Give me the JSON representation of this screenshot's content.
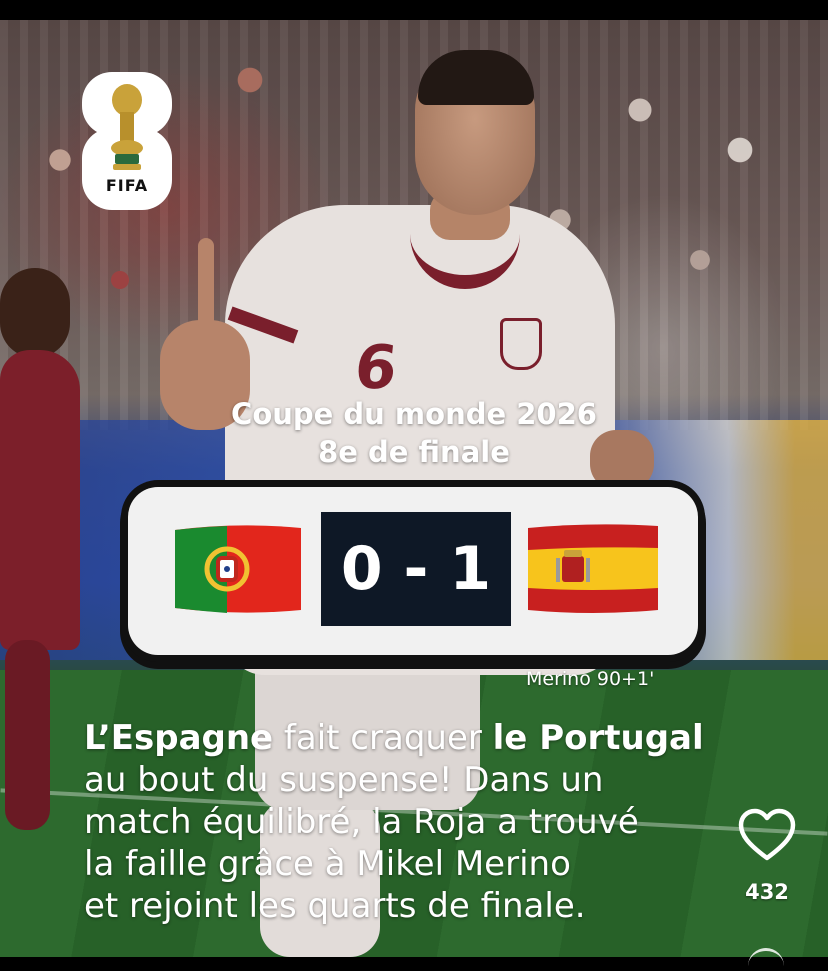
{
  "logo": {
    "badge_text": "FIFA",
    "year_graphic": "26"
  },
  "match": {
    "competition_line1": "Coupe du monde 2026",
    "competition_line2": "8e de finale",
    "home_team_flag": "portugal-flag",
    "away_team_flag": "spain-flag",
    "score": "0 - 1",
    "scorer": "Merino 90+1'"
  },
  "caption": {
    "team1": "L’Espagne",
    "text1": " fait craquer ",
    "team2": "le Portugal",
    "line2": "au bout du suspense! Dans un",
    "line3": "match équilibré, la Roja a trouvé",
    "line4": "la faille grâce à Mikel Merino",
    "line5": "et rejoint les quarts de finale."
  },
  "actions": {
    "like_icon": "heart-icon",
    "like_count": "432"
  },
  "colors": {
    "scoreboard_bg": "#f1f1f1",
    "score_box": "#0e1826",
    "jersey_accent": "#7a1f2c"
  }
}
